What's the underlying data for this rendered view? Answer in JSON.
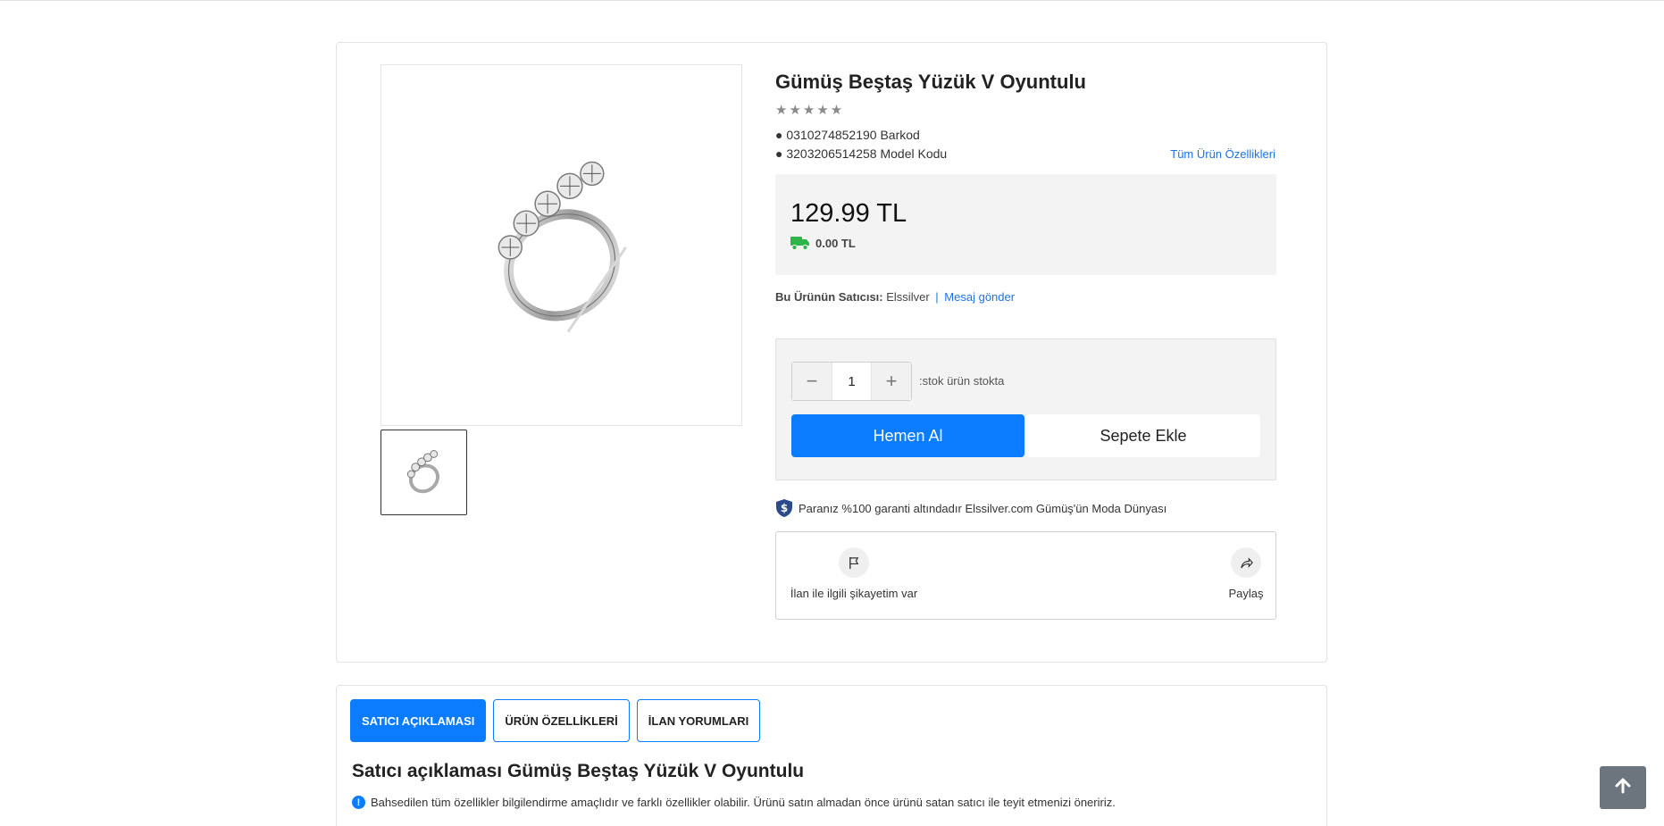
{
  "product": {
    "title": "Gümüş Beştaş Yüzük V Oyuntulu",
    "stars": "★★★★★",
    "barcode_line": "● 0310274852190 Barkod",
    "model_line": "● 3203206514258 Model Kodu",
    "all_features_link": "Tüm Ürün Özellikleri"
  },
  "pricing": {
    "price": "129.99 TL",
    "shipping": "0.00 TL",
    "shipping_icon": "truck-icon",
    "shipping_color": "#2fb44a"
  },
  "seller": {
    "label": "Bu Ürünün Satıcısı:",
    "name": "Elssilver",
    "separator": "|",
    "message_link": "Mesaj gönder"
  },
  "purchase": {
    "minus": "−",
    "quantity": "1",
    "plus": "+",
    "stock_text": ":stok ürün stokta",
    "buy_now": "Hemen Al",
    "add_to_cart": "Sepete Ekle",
    "accent": "#0b7cff"
  },
  "guarantee": {
    "icon": "shield-icon",
    "text": "Paranız %100 garanti altındadır Elssilver.com Gümüş'ün Moda Dünyası"
  },
  "actions": {
    "report": {
      "icon": "flag-icon",
      "label": "İlan ile ilgili şikayetim var"
    },
    "share": {
      "icon": "share-icon",
      "label": "Paylaş"
    }
  },
  "tabs": [
    {
      "label": "SATICI AÇIKLAMASI",
      "active": true
    },
    {
      "label": "ÜRÜN ÖZELLİKLERİ",
      "active": false
    },
    {
      "label": "İLAN YORUMLARI",
      "active": false
    }
  ],
  "description": {
    "title": "Satıcı açıklaması Gümüş Beştaş Yüzük V Oyuntulu",
    "notice_icon": "!",
    "notice": "Bahsedilen tüm özellikler bilgilendirme amaçlıdır ve farklı özellikler olabilir. Ürünü satın almadan önce ürünü satan satıcı ile teyit etmenizi öneririz."
  },
  "scroll_top": {
    "icon": "arrow-up-icon"
  }
}
